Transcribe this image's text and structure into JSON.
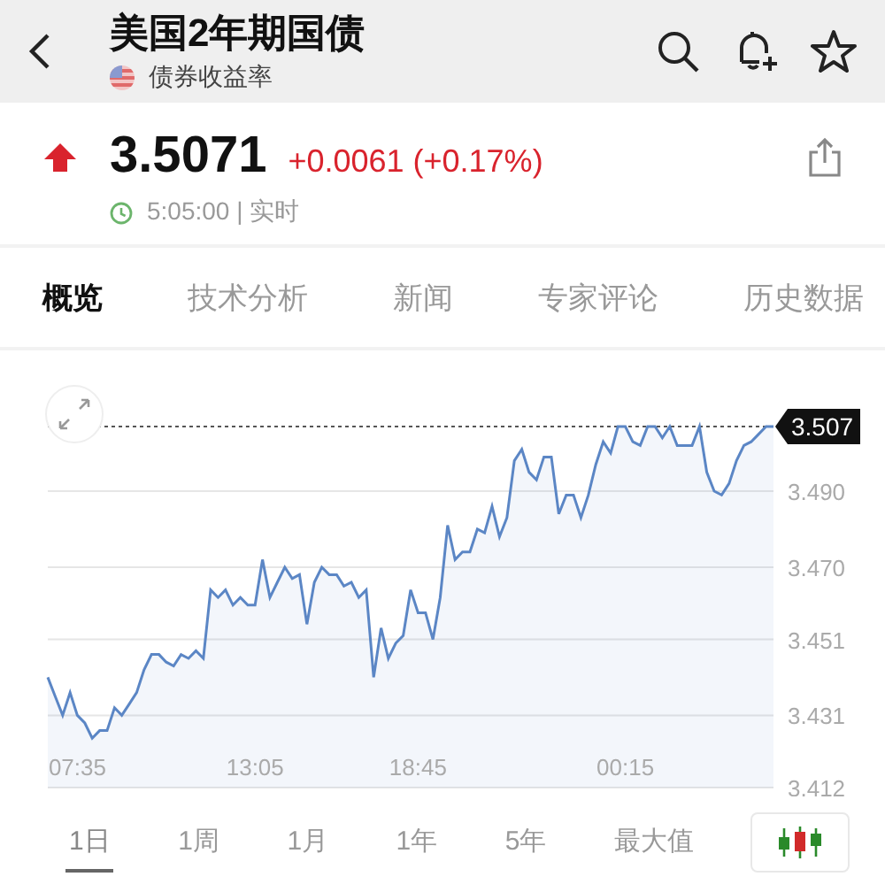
{
  "header": {
    "title": "美国2年期国债",
    "subtitle": "债券收益率"
  },
  "quote": {
    "rising": true,
    "price": "3.5071",
    "change": "+0.0061 (+0.17%)",
    "time": "5:05:00 | 实时"
  },
  "tabs": [
    {
      "label": "概览",
      "selected": true
    },
    {
      "label": "技术分析",
      "selected": false
    },
    {
      "label": "新闻",
      "selected": false
    },
    {
      "label": "专家评论",
      "selected": false
    },
    {
      "label": "历史数据",
      "selected": false
    }
  ],
  "chart": {
    "chart_data": {
      "type": "area",
      "categories": [
        null,
        null,
        null,
        null,
        "07:35",
        null,
        null,
        null,
        null,
        null,
        null,
        null,
        null,
        null,
        null,
        null,
        null,
        null,
        null,
        null,
        null,
        null,
        null,
        null,
        null,
        null,
        null,
        null,
        "13:05",
        null,
        null,
        null,
        null,
        null,
        null,
        null,
        null,
        null,
        null,
        null,
        null,
        null,
        null,
        null,
        null,
        null,
        null,
        null,
        null,
        null,
        "18:45",
        null,
        null,
        null,
        null,
        null,
        null,
        null,
        null,
        null,
        null,
        null,
        null,
        null,
        null,
        null,
        null,
        null,
        null,
        null,
        null,
        null,
        null,
        null,
        null,
        null,
        null,
        null,
        "00:15",
        null,
        null,
        null,
        null,
        null,
        null,
        null,
        null,
        null,
        null,
        null,
        null,
        null,
        null,
        null,
        null,
        null,
        null,
        null,
        null
      ],
      "series": [
        {
          "color": "#5b86c5",
          "values": [
            3.441,
            3.436,
            3.431,
            3.437,
            3.431,
            3.429,
            3.425,
            3.427,
            3.427,
            3.433,
            3.431,
            3.434,
            3.437,
            3.443,
            3.447,
            3.447,
            3.445,
            3.444,
            3.447,
            3.446,
            3.448,
            3.446,
            3.464,
            3.462,
            3.464,
            3.46,
            3.462,
            3.46,
            3.46,
            3.472,
            3.462,
            3.466,
            3.47,
            3.467,
            3.468,
            3.455,
            3.466,
            3.47,
            3.468,
            3.468,
            3.465,
            3.466,
            3.462,
            3.464,
            3.441,
            3.454,
            3.446,
            3.45,
            3.452,
            3.464,
            3.458,
            3.458,
            3.451,
            3.462,
            3.481,
            3.472,
            3.474,
            3.474,
            3.48,
            3.479,
            3.486,
            3.478,
            3.483,
            3.498,
            3.501,
            3.495,
            3.493,
            3.499,
            3.499,
            3.484,
            3.489,
            3.489,
            3.483,
            3.489,
            3.497,
            3.503,
            3.5,
            3.507,
            3.507,
            3.503,
            3.502,
            3.507,
            3.507,
            3.504,
            3.507,
            3.502,
            3.502,
            3.502,
            3.507,
            3.495,
            3.49,
            3.489,
            3.492,
            3.498,
            3.502,
            3.503,
            3.505,
            3.507,
            3.507
          ]
        }
      ],
      "ylim": [
        3.412,
        3.507
      ],
      "grid": true,
      "yticks": [
        {
          "value": 3.412,
          "label": "3.412"
        },
        {
          "value": 3.431,
          "label": "3.431"
        },
        {
          "value": 3.451,
          "label": "3.451"
        },
        {
          "value": 3.47,
          "label": "3.470"
        },
        {
          "value": 3.49,
          "label": "3.490"
        },
        {
          "value": 3.507,
          "label": "3.507"
        }
      ]
    }
  },
  "ranges": [
    {
      "label": "1日",
      "selected": true
    },
    {
      "label": "1周",
      "selected": false
    },
    {
      "label": "1月",
      "selected": false
    },
    {
      "label": "1年",
      "selected": false
    },
    {
      "label": "5年",
      "selected": false
    },
    {
      "label": "最大值",
      "selected": false
    }
  ]
}
